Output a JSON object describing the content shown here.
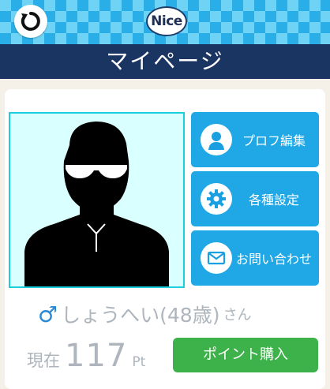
{
  "header": {
    "logo_text": "Nice",
    "title": "マイページ"
  },
  "menu": {
    "profile_edit": "プロフ編集",
    "settings": "各種設定",
    "inquiry": "お問い合わせ"
  },
  "user": {
    "gender_symbol": "♂",
    "name": "しょうへい",
    "age": "(48歳)",
    "honorific": "さん"
  },
  "points": {
    "current_label": "現在",
    "value": "117",
    "unit": "Pt",
    "buy_label": "ポイント購入"
  },
  "icons": {
    "back": "refresh-back-icon",
    "profile": "person-icon",
    "settings": "gear-icon",
    "inquiry": "mail-icon"
  },
  "colors": {
    "header_blue": "#1b3563",
    "menu_blue": "#1fa7e6",
    "buy_green": "#3db24a",
    "avatar_bg": "#d9ffff"
  }
}
